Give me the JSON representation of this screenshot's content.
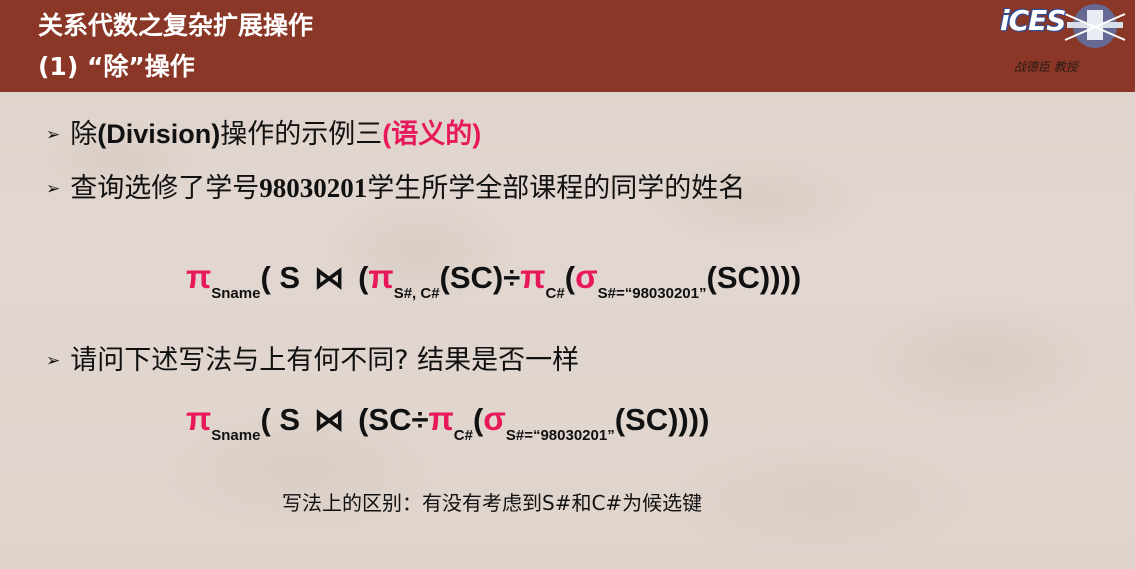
{
  "header": {
    "title_line1": "关系代数之复杂扩展操作",
    "title_line2": "(1) “除”操作",
    "logo_text": "iCES",
    "author": "战德臣 教授"
  },
  "colors": {
    "header_bg": "#8a3727",
    "accent_red": "#e8195a"
  },
  "bullets": {
    "b1_pre": "除",
    "b1_bold": "(Division)",
    "b1_mid": "操作的示例三",
    "b1_red": "(语义的)",
    "b2_pre": "查询选修了学号",
    "b2_num": "98030201",
    "b2_post": "学生所学全部课程的同学的姓名",
    "b3": "请问下述写法与上有何不同? 结果是否一样"
  },
  "formula1": {
    "pi": "π",
    "sub_sname": "Sname",
    "open": "( S",
    "join": "⋈",
    "open2": "(",
    "pi2": "π",
    "sub_sc": "S#, C#",
    "sc": "(SC)",
    "div": "÷",
    "pi3": "π",
    "sub_c": "C#",
    "open3": "(",
    "sigma": "σ",
    "sub_cond": "S#=“98030201”",
    "close": "(SC))))"
  },
  "formula2": {
    "pi": "π",
    "sub_sname": "Sname",
    "open": "( S",
    "join": "⋈",
    "open2": "(SC",
    "div": "÷",
    "pi3": "π",
    "sub_c": "C#",
    "open3": "(",
    "sigma": "σ",
    "sub_cond": "S#=“98030201”",
    "close": "(SC))))"
  },
  "note": "写法上的区别：有没有考虑到S#和C#为候选键"
}
